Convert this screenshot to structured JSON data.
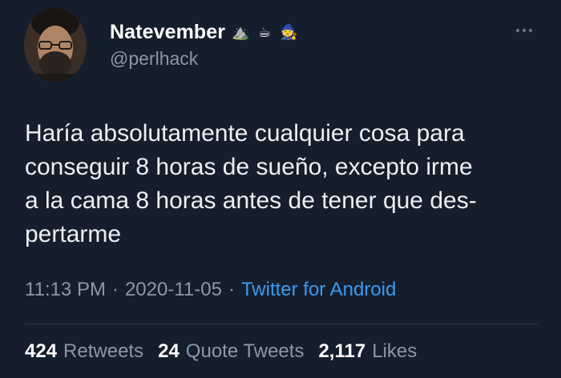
{
  "author": {
    "display_name": "Natevember",
    "handle": "@perlhack",
    "name_emojis": [
      "⛰️",
      "☕",
      "🧙"
    ]
  },
  "tweet": {
    "text": "Haría absolutamente cualquier cosa para\nconseguir 8 horas de sueño, excepto irme\na la cama 8 horas antes de tener que des-\npertarme",
    "time": "11:13 PM",
    "date": "2020-11-05",
    "separator": "·",
    "source": "Twitter for Android"
  },
  "stats": {
    "retweets": {
      "count": "424",
      "label": "Retweets"
    },
    "quotes": {
      "count": "24",
      "label": "Quote Tweets"
    },
    "likes": {
      "count": "2,117",
      "label": "Likes"
    }
  },
  "icons": {
    "more": "more-horizontal-icon"
  },
  "colors": {
    "background": "#151e2c",
    "link": "#3a9bef",
    "muted": "#8b98a5"
  }
}
